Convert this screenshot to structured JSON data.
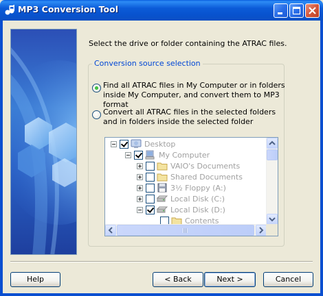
{
  "window": {
    "title": "MP3 Conversion Tool"
  },
  "main": {
    "instruction": "Select the drive or folder containing the ATRAC files.",
    "group_title": "Conversion source selection",
    "options": [
      {
        "label": "Find all ATRAC files in My Computer or in folders inside My Computer, and convert them to MP3 format",
        "selected": true
      },
      {
        "label": "Convert all ATRAC files in the selected folders and in folders inside the selected folder",
        "selected": false
      }
    ],
    "tree": {
      "enabled": false,
      "items": [
        {
          "label": "Desktop",
          "expander": "minus",
          "checked": true,
          "icon": "desktop-icon"
        },
        {
          "label": "My Computer",
          "expander": "minus",
          "checked": true,
          "icon": "computer-icon"
        },
        {
          "label": "VAIO's Documents",
          "expander": "plus",
          "checked": false,
          "icon": "folder-icon"
        },
        {
          "label": "Shared Documents",
          "expander": "plus",
          "checked": false,
          "icon": "folder-icon"
        },
        {
          "label": "3½ Floppy (A:)",
          "expander": "plus",
          "checked": false,
          "icon": "floppy-icon"
        },
        {
          "label": "Local Disk (C:)",
          "expander": "plus",
          "checked": false,
          "icon": "disk-icon"
        },
        {
          "label": "Local Disk (D:)",
          "expander": "minus",
          "checked": true,
          "icon": "disk-icon"
        },
        {
          "label": "Contents",
          "expander": "none",
          "checked": false,
          "icon": "folder-icon"
        }
      ]
    }
  },
  "footer": {
    "help_label": "Help",
    "back_label": "< Back",
    "next_label": "Next >",
    "cancel_label": "Cancel"
  },
  "colors": {
    "title_bar": "#0a5fe0",
    "legend_text": "#0046d5",
    "dialog_bg": "#ece9d8",
    "disabled_text": "#a0a0a0"
  }
}
